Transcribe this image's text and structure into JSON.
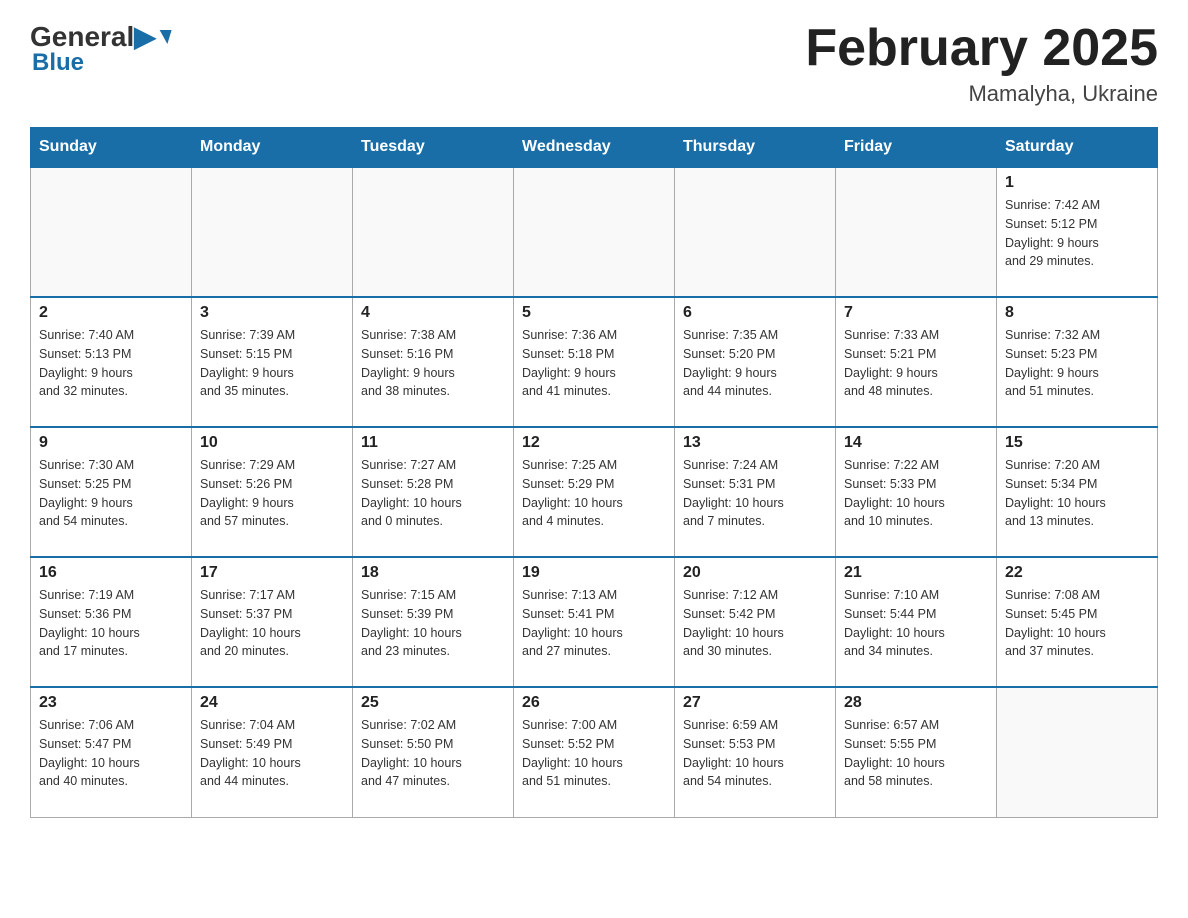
{
  "header": {
    "logo_general": "General",
    "logo_blue": "Blue",
    "month_title": "February 2025",
    "location": "Mamalyha, Ukraine"
  },
  "weekdays": [
    "Sunday",
    "Monday",
    "Tuesday",
    "Wednesday",
    "Thursday",
    "Friday",
    "Saturday"
  ],
  "weeks": [
    {
      "days": [
        {
          "number": "",
          "info": ""
        },
        {
          "number": "",
          "info": ""
        },
        {
          "number": "",
          "info": ""
        },
        {
          "number": "",
          "info": ""
        },
        {
          "number": "",
          "info": ""
        },
        {
          "number": "",
          "info": ""
        },
        {
          "number": "1",
          "info": "Sunrise: 7:42 AM\nSunset: 5:12 PM\nDaylight: 9 hours\nand 29 minutes."
        }
      ]
    },
    {
      "days": [
        {
          "number": "2",
          "info": "Sunrise: 7:40 AM\nSunset: 5:13 PM\nDaylight: 9 hours\nand 32 minutes."
        },
        {
          "number": "3",
          "info": "Sunrise: 7:39 AM\nSunset: 5:15 PM\nDaylight: 9 hours\nand 35 minutes."
        },
        {
          "number": "4",
          "info": "Sunrise: 7:38 AM\nSunset: 5:16 PM\nDaylight: 9 hours\nand 38 minutes."
        },
        {
          "number": "5",
          "info": "Sunrise: 7:36 AM\nSunset: 5:18 PM\nDaylight: 9 hours\nand 41 minutes."
        },
        {
          "number": "6",
          "info": "Sunrise: 7:35 AM\nSunset: 5:20 PM\nDaylight: 9 hours\nand 44 minutes."
        },
        {
          "number": "7",
          "info": "Sunrise: 7:33 AM\nSunset: 5:21 PM\nDaylight: 9 hours\nand 48 minutes."
        },
        {
          "number": "8",
          "info": "Sunrise: 7:32 AM\nSunset: 5:23 PM\nDaylight: 9 hours\nand 51 minutes."
        }
      ]
    },
    {
      "days": [
        {
          "number": "9",
          "info": "Sunrise: 7:30 AM\nSunset: 5:25 PM\nDaylight: 9 hours\nand 54 minutes."
        },
        {
          "number": "10",
          "info": "Sunrise: 7:29 AM\nSunset: 5:26 PM\nDaylight: 9 hours\nand 57 minutes."
        },
        {
          "number": "11",
          "info": "Sunrise: 7:27 AM\nSunset: 5:28 PM\nDaylight: 10 hours\nand 0 minutes."
        },
        {
          "number": "12",
          "info": "Sunrise: 7:25 AM\nSunset: 5:29 PM\nDaylight: 10 hours\nand 4 minutes."
        },
        {
          "number": "13",
          "info": "Sunrise: 7:24 AM\nSunset: 5:31 PM\nDaylight: 10 hours\nand 7 minutes."
        },
        {
          "number": "14",
          "info": "Sunrise: 7:22 AM\nSunset: 5:33 PM\nDaylight: 10 hours\nand 10 minutes."
        },
        {
          "number": "15",
          "info": "Sunrise: 7:20 AM\nSunset: 5:34 PM\nDaylight: 10 hours\nand 13 minutes."
        }
      ]
    },
    {
      "days": [
        {
          "number": "16",
          "info": "Sunrise: 7:19 AM\nSunset: 5:36 PM\nDaylight: 10 hours\nand 17 minutes."
        },
        {
          "number": "17",
          "info": "Sunrise: 7:17 AM\nSunset: 5:37 PM\nDaylight: 10 hours\nand 20 minutes."
        },
        {
          "number": "18",
          "info": "Sunrise: 7:15 AM\nSunset: 5:39 PM\nDaylight: 10 hours\nand 23 minutes."
        },
        {
          "number": "19",
          "info": "Sunrise: 7:13 AM\nSunset: 5:41 PM\nDaylight: 10 hours\nand 27 minutes."
        },
        {
          "number": "20",
          "info": "Sunrise: 7:12 AM\nSunset: 5:42 PM\nDaylight: 10 hours\nand 30 minutes."
        },
        {
          "number": "21",
          "info": "Sunrise: 7:10 AM\nSunset: 5:44 PM\nDaylight: 10 hours\nand 34 minutes."
        },
        {
          "number": "22",
          "info": "Sunrise: 7:08 AM\nSunset: 5:45 PM\nDaylight: 10 hours\nand 37 minutes."
        }
      ]
    },
    {
      "days": [
        {
          "number": "23",
          "info": "Sunrise: 7:06 AM\nSunset: 5:47 PM\nDaylight: 10 hours\nand 40 minutes."
        },
        {
          "number": "24",
          "info": "Sunrise: 7:04 AM\nSunset: 5:49 PM\nDaylight: 10 hours\nand 44 minutes."
        },
        {
          "number": "25",
          "info": "Sunrise: 7:02 AM\nSunset: 5:50 PM\nDaylight: 10 hours\nand 47 minutes."
        },
        {
          "number": "26",
          "info": "Sunrise: 7:00 AM\nSunset: 5:52 PM\nDaylight: 10 hours\nand 51 minutes."
        },
        {
          "number": "27",
          "info": "Sunrise: 6:59 AM\nSunset: 5:53 PM\nDaylight: 10 hours\nand 54 minutes."
        },
        {
          "number": "28",
          "info": "Sunrise: 6:57 AM\nSunset: 5:55 PM\nDaylight: 10 hours\nand 58 minutes."
        },
        {
          "number": "",
          "info": ""
        }
      ]
    }
  ]
}
